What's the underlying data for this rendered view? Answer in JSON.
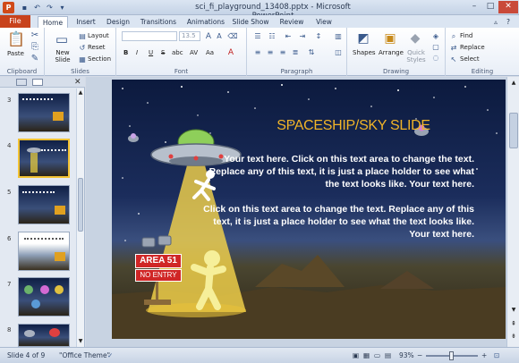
{
  "window": {
    "title": "sci_fi_playground_13408.pptx - Microsoft PowerPoint",
    "app_icon_label": "P"
  },
  "quick_access": [
    "save-icon",
    "undo-icon",
    "redo-icon",
    "customize-icon"
  ],
  "tabs": {
    "file": "File",
    "items": [
      "Home",
      "Insert",
      "Design",
      "Transitions",
      "Animations",
      "Slide Show",
      "Review",
      "View"
    ],
    "active": "Home"
  },
  "ribbon": {
    "clipboard": {
      "label": "Clipboard",
      "paste": "Paste"
    },
    "slides": {
      "label": "Slides",
      "new_slide": "New Slide",
      "layout": "Layout",
      "reset": "Reset",
      "section": "Section"
    },
    "font": {
      "label": "Font",
      "size": "13.5",
      "bold": "B",
      "italic": "I",
      "underline": "U",
      "strike": "S",
      "shadow": "abc",
      "spacing": "AV",
      "case": "Aa"
    },
    "paragraph": {
      "label": "Paragraph"
    },
    "drawing": {
      "label": "Drawing",
      "shapes": "Shapes",
      "arrange": "Arrange",
      "quick_styles": "Quick Styles"
    },
    "editing": {
      "label": "Editing",
      "find": "Find",
      "replace": "Replace",
      "select": "Select"
    }
  },
  "thumbnails": [
    {
      "num": "3",
      "selected": false
    },
    {
      "num": "4",
      "selected": true
    },
    {
      "num": "5",
      "selected": false
    },
    {
      "num": "6",
      "selected": false
    },
    {
      "num": "7",
      "selected": false
    },
    {
      "num": "8",
      "selected": false
    }
  ],
  "slide": {
    "title": "SPACESHIP/SKY SLIDE",
    "para1": "Your text here. Click on this text area to change the text. Replace any of this text, it is just a place holder to see what the text looks like. Your text here.",
    "para2": "Click on this text area to change the text. Replace any of this text, it is just a place holder to see what the text looks like. Your text here.",
    "sign_line1": "AREA 51",
    "sign_line2": "NO ENTRY"
  },
  "status": {
    "slide_info": "Slide 4 of 9",
    "theme": "\"Office Theme\"",
    "zoom": "93%",
    "zoom_minus": "−",
    "zoom_plus": "+"
  }
}
